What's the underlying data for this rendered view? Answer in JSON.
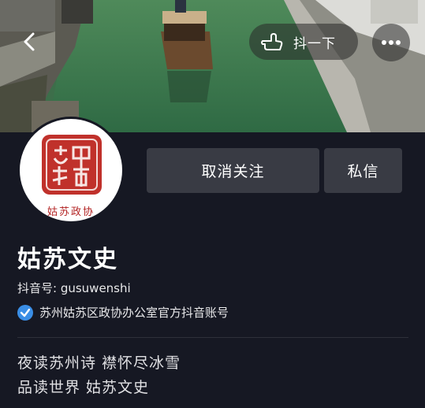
{
  "header": {
    "back_icon": "chevron-left-icon",
    "shake_label": "抖一下",
    "shake_icon": "hand-point-icon",
    "more_icon": "ellipsis-icon"
  },
  "profile": {
    "avatar_seal_text": "姑苏政协",
    "name": "姑苏文史",
    "douyin_id": "抖音号: gusuwenshi",
    "verified_icon": "verified-check-icon",
    "verified_color": "#3a8ee6",
    "verified_text": "苏州姑苏区政协办公室官方抖音账号",
    "bio_line1": "夜读苏州诗 襟怀尽冰雪",
    "bio_line2": "品读世界 姑苏文史"
  },
  "actions": {
    "unfollow_label": "取消关注",
    "message_label": "私信"
  }
}
